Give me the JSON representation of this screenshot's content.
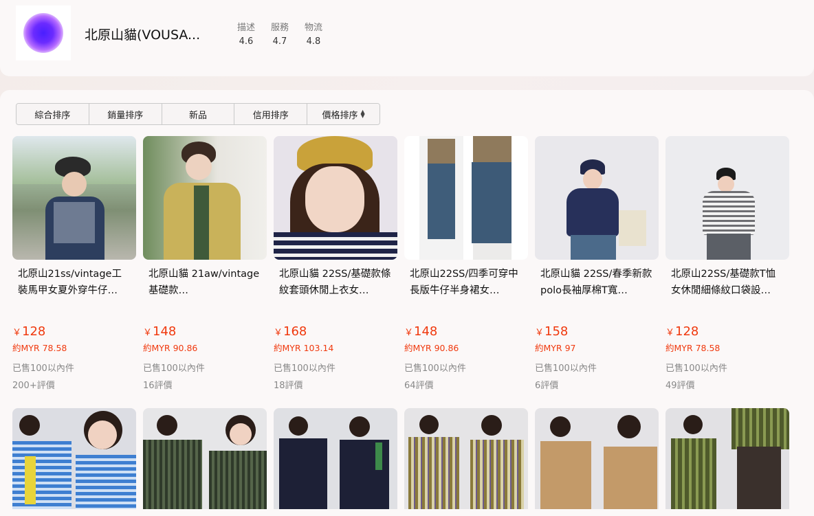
{
  "shop": {
    "name": "北原山貓(VOUSA...",
    "ratings": [
      {
        "label": "描述",
        "value": "4.6"
      },
      {
        "label": "服務",
        "value": "4.7"
      },
      {
        "label": "物流",
        "value": "4.8"
      }
    ]
  },
  "sort_tabs": [
    {
      "label": "綜合排序"
    },
    {
      "label": "銷量排序"
    },
    {
      "label": "新品"
    },
    {
      "label": "信用排序"
    },
    {
      "label": "價格排序"
    }
  ],
  "products": [
    {
      "title": "北原山21ss/vintage工裝馬甲女夏外穿牛仔…",
      "price": "128",
      "currency_symbol": "￥",
      "myr": "約MYR 78.58",
      "sold": "已售100以內件",
      "reviews": "200+評價"
    },
    {
      "title": "北原山貓 21aw/vintage基礎款…",
      "price": "148",
      "currency_symbol": "￥",
      "myr": "約MYR 90.86",
      "sold": "已售100以內件",
      "reviews": "16評價"
    },
    {
      "title": "北原山貓 22SS/基礎款條紋套頭休閒上衣女…",
      "price": "168",
      "currency_symbol": "￥",
      "myr": "約MYR 103.14",
      "sold": "已售100以內件",
      "reviews": "18評價"
    },
    {
      "title": "北原山22SS/四季可穿中長版牛仔半身裙女…",
      "price": "148",
      "currency_symbol": "￥",
      "myr": "約MYR 90.86",
      "sold": "已售100以內件",
      "reviews": "64評價"
    },
    {
      "title": "北原山貓 22SS/春季新款polo長袖厚棉T寬…",
      "price": "158",
      "currency_symbol": "￥",
      "myr": "約MYR 97",
      "sold": "已售100以內件",
      "reviews": "6評價"
    },
    {
      "title": "北原山22SS/基礎款T恤女休閒細條紋口袋設…",
      "price": "128",
      "currency_symbol": "￥",
      "myr": "約MYR 78.58",
      "sold": "已售100以內件",
      "reviews": "49評價"
    }
  ],
  "colors": {
    "price": "#f0390e",
    "muted": "#888888"
  }
}
